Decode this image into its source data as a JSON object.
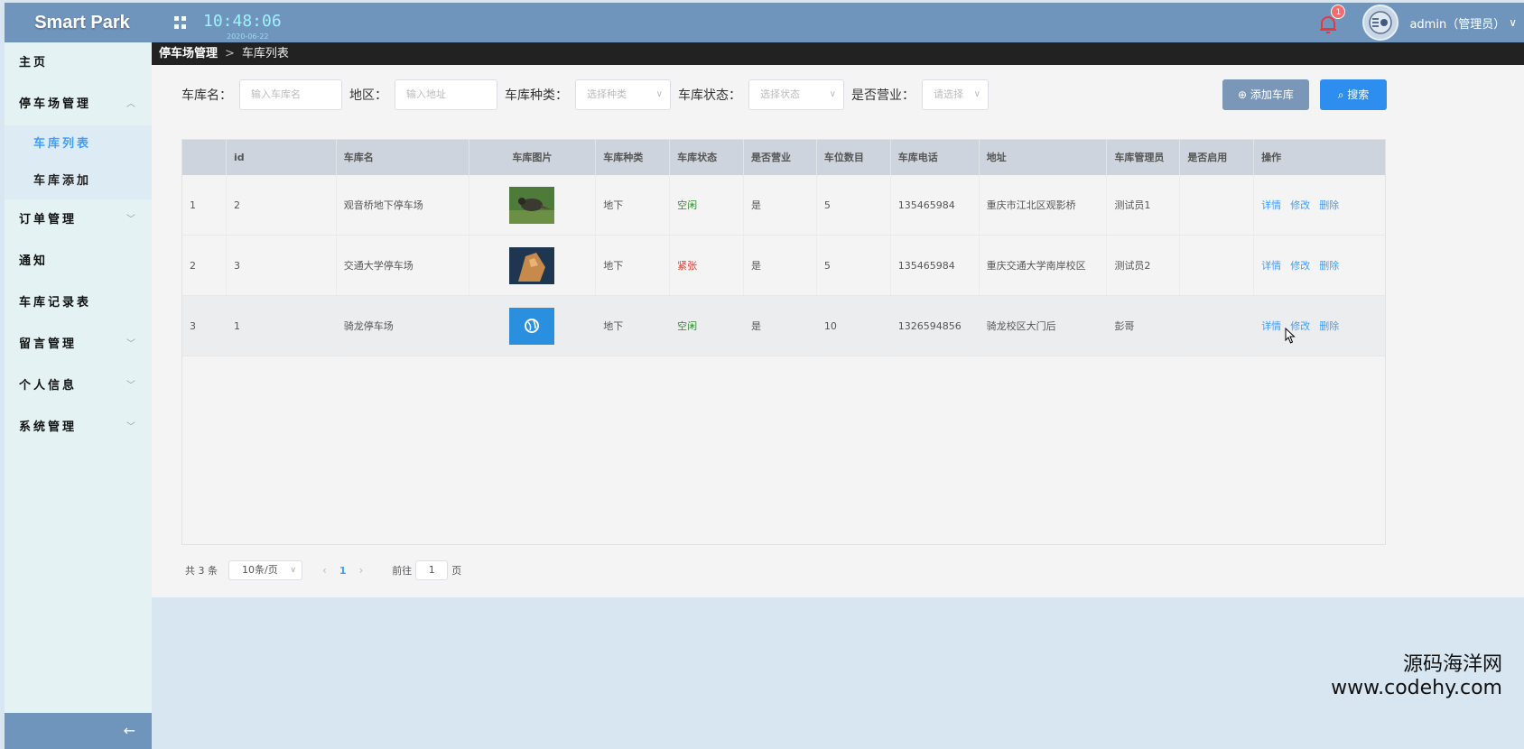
{
  "header": {
    "brand": "Smart Park",
    "time": "10:48:06",
    "date": "2020-06-22",
    "notifications": "1",
    "username": "admin（管理员）"
  },
  "sidebar": {
    "items": [
      {
        "label": "主页"
      },
      {
        "label": "停车场管理"
      },
      {
        "label": "订单管理"
      },
      {
        "label": "通知"
      },
      {
        "label": "车库记录表"
      },
      {
        "label": "留言管理"
      },
      {
        "label": "个人信息"
      },
      {
        "label": "系统管理"
      }
    ],
    "sub_items": [
      {
        "label": "车库列表"
      },
      {
        "label": "车库添加"
      }
    ],
    "collapse_icon": "←"
  },
  "breadcrumb": {
    "parent": "停车场管理",
    "current": "车库列表"
  },
  "filters": {
    "name_label": "车库名：",
    "name_placeholder": "输入车库名",
    "area_label": "地区：",
    "area_placeholder": "输入地址",
    "type_label": "车库种类：",
    "type_placeholder": "选择种类",
    "status_label": "车库状态：",
    "status_placeholder": "选择状态",
    "open_label": "是否营业：",
    "open_placeholder": "请选择",
    "add_button": "添加车库",
    "search_button": "搜索"
  },
  "table": {
    "headers": [
      "",
      "id",
      "车库名",
      "车库图片",
      "车库种类",
      "车库状态",
      "是否营业",
      "车位数目",
      "车库电话",
      "地址",
      "车库管理员",
      "是否启用",
      "操作"
    ],
    "rows": [
      {
        "index": "1",
        "id": "2",
        "name": "观音桥地下停车场",
        "type": "地下",
        "status": "空闲",
        "open": "是",
        "spots": "5",
        "phone": "135465984",
        "address": "重庆市江北区观影桥",
        "manager": "测试员1",
        "enabled": ""
      },
      {
        "index": "2",
        "id": "3",
        "name": "交通大学停车场",
        "type": "地下",
        "status": "紧张",
        "open": "是",
        "spots": "5",
        "phone": "135465984",
        "address": "重庆交通大学南岸校区",
        "manager": "测试员2",
        "enabled": ""
      },
      {
        "index": "3",
        "id": "1",
        "name": "骑龙停车场",
        "type": "地下",
        "status": "空闲",
        "open": "是",
        "spots": "10",
        "phone": "1326594856",
        "address": "骑龙校区大门后",
        "manager": "彭哥",
        "enabled": ""
      }
    ],
    "actions": {
      "detail": "详情",
      "edit": "修改",
      "delete": "删除"
    }
  },
  "pager": {
    "total": "共 3 条",
    "page_size": "10条/页",
    "current": "1",
    "goto_label": "前往",
    "goto_value": "1",
    "page_unit": "页"
  },
  "watermark": {
    "line1": "源码海洋网",
    "line2": "www.codehy.com"
  },
  "colors": {
    "header": "#7095bd",
    "sidebar": "#e4f2f4",
    "accent": "#409eff",
    "free": "#2e8b2e",
    "busy": "#e03b2e"
  }
}
